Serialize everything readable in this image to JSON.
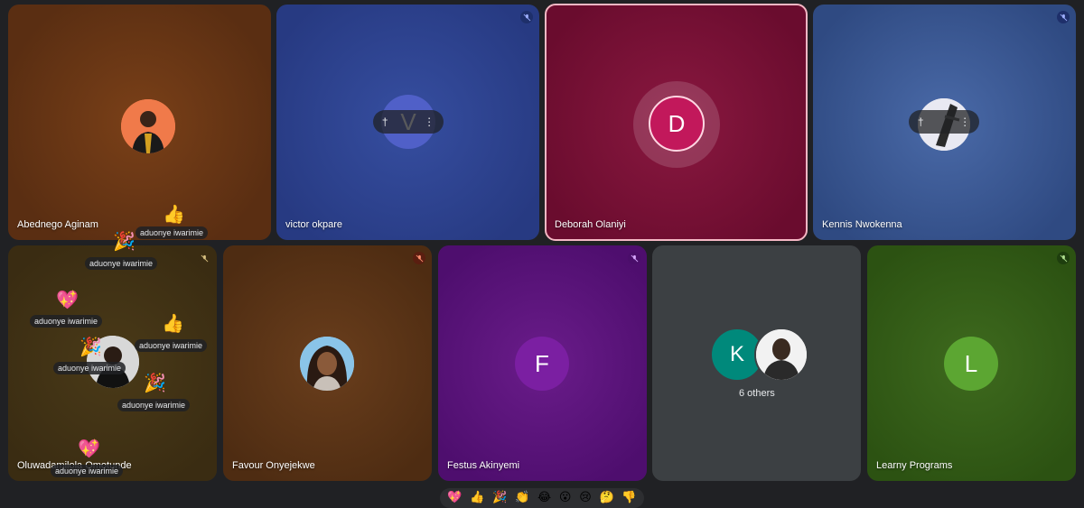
{
  "participants": [
    {
      "name": "Abednego Aginam"
    },
    {
      "name": "victor okpare",
      "initial": "V"
    },
    {
      "name": "Deborah Olaniyi",
      "initial": "D"
    },
    {
      "name": "Kennis Nwokenna"
    },
    {
      "name": "Oluwadamilola Omotunde"
    },
    {
      "name": "Favour Onyejekwe"
    },
    {
      "name": "Festus Akinyemi",
      "initial": "F"
    },
    {
      "name": "Learny Programs",
      "initial": "L"
    }
  ],
  "others": {
    "initial": "K",
    "label": "6 others"
  },
  "hover_controls": {
    "pin": "†",
    "more": "⋮"
  },
  "reactions_overlay": {
    "sender": "aduonye iwarimie",
    "items": [
      {
        "emoji": "👍",
        "label": "aduonye iwarimie"
      },
      {
        "emoji": "🎉",
        "label": "aduonye iwarimie"
      },
      {
        "emoji": "💖",
        "label": "aduonye iwarimie"
      },
      {
        "emoji": "👍",
        "label": "aduonye iwarimie"
      },
      {
        "emoji": "🎉",
        "label": "aduonye iwarimie"
      },
      {
        "emoji": "🎉",
        "label": "aduonye iwarimie"
      },
      {
        "emoji": "💖",
        "label": "aduonye iwarimie"
      }
    ]
  },
  "reaction_bar": [
    {
      "emoji": "💖",
      "icon": "sparkling-heart-icon"
    },
    {
      "emoji": "👍",
      "icon": "thumbs-up-icon"
    },
    {
      "emoji": "🎉",
      "icon": "party-popper-icon"
    },
    {
      "emoji": "👏",
      "icon": "clapping-hands-icon"
    },
    {
      "emoji": "😂",
      "icon": "tears-of-joy-icon"
    },
    {
      "emoji": "😮",
      "icon": "surprised-face-icon"
    },
    {
      "emoji": "😢",
      "icon": "crying-face-icon"
    },
    {
      "emoji": "🤔",
      "icon": "thinking-face-icon"
    },
    {
      "emoji": "👎",
      "icon": "thumbs-down-icon"
    }
  ],
  "colors": {
    "background": "#202124",
    "active_speaker_border": "#f5b7c4",
    "deborah_avatar": "#c2185b",
    "festus_avatar": "#7b1fa2",
    "learny_avatar": "#5ca632",
    "others_k_avatar": "#00897b",
    "victor_avatar": "#5060c8"
  }
}
